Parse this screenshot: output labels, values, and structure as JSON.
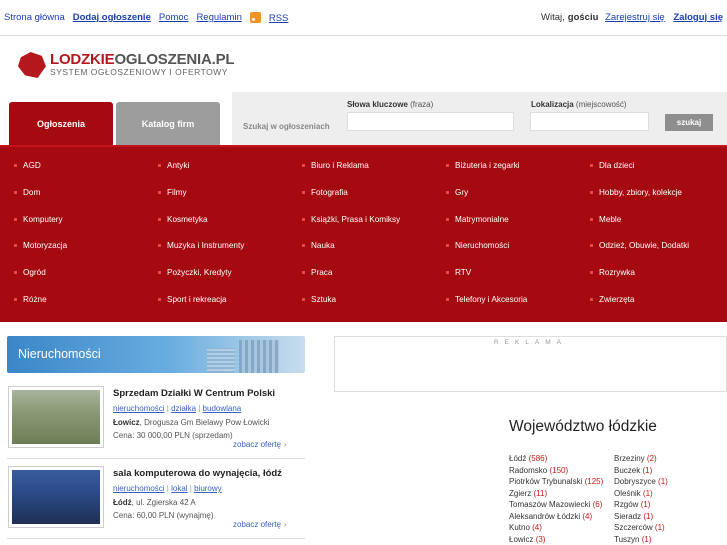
{
  "topbar": {
    "links": {
      "home": "Strona główna",
      "add": "Dodaj ogłoszenie",
      "help": "Pomoc",
      "terms": "Regulamin",
      "rss": "RSS"
    },
    "greeting_prefix": "Witaj,",
    "greeting_user": "gościu",
    "register": "Zarejestruj się",
    "login": "Zaloguj się"
  },
  "logo": {
    "title_red": "LODZKIE",
    "title_gray": "OGLOSZENIA.PL",
    "subtitle": "SYSTEM OGŁOSZENIOWY I OFERTOWY"
  },
  "tabs": {
    "ads": "Ogłoszenia",
    "catalog": "Katalog firm"
  },
  "search": {
    "label": "Szukaj w ogłoszeniach",
    "keywords_label": "Słowa kluczowe",
    "keywords_hint": "(fraza)",
    "location_label": "Lokalizacja",
    "location_hint": "(miejscowość)",
    "keywords_value": "",
    "location_value": "",
    "button": "szukaj"
  },
  "categories": [
    "AGD",
    "Antyki",
    "Biuro i Reklama",
    "Biżuteria i zegarki",
    "Dla dzieci",
    "Dom",
    "Filmy",
    "Fotografia",
    "Gry",
    "Hobby, zbiory, kolekcje",
    "Komputery",
    "Kosmetyka",
    "Książki, Prasa i Komiksy",
    "Matrymonialne",
    "Meble",
    "Motoryzacja",
    "Muzyka i Instrumenty",
    "Nauka",
    "Nieruchomości",
    "Odzież, Obuwie, Dodatki",
    "Ogród",
    "Pożyczki, Kredyty",
    "Praca",
    "RTV",
    "Rozrywka",
    "Różne",
    "Sport i rekreacja",
    "Sztuka",
    "Telefony i Akcesoria",
    "Zwierzęta"
  ],
  "section": {
    "title": "Nieruchomości"
  },
  "listings": [
    {
      "title": "Sprzedam Działki W Centrum Polski",
      "tags": [
        "nieruchomości",
        "działka",
        "budowlana"
      ],
      "city": "Łowicz",
      "address": ", Drogusza Gm Bielawy Pow Łowicki",
      "price": "Cena: 30 000,00 PLN (sprzedam)",
      "more": "zobacz ofertę"
    },
    {
      "title": "sala komputerowa do wynajęcia, łódź",
      "tags": [
        "nieruchomości",
        "lokal",
        "biurowy"
      ],
      "city": "Łódź",
      "address": ", ul. Zgierska 42 A",
      "price": "Cena: 60,00 PLN (wynajmę)",
      "more": "zobacz ofertę"
    }
  ],
  "ad": {
    "label": "REKLAMA"
  },
  "region": {
    "title": "Województwo łódzkie",
    "col1": [
      {
        "name": "Łódź",
        "count": "(586)"
      },
      {
        "name": "Radomsko",
        "count": "(150)"
      },
      {
        "name": "Piotrków Trybunalski",
        "count": "(125)"
      },
      {
        "name": "Zgierz",
        "count": "(11)"
      },
      {
        "name": "Tomaszów Mazowiecki",
        "count": "(6)"
      },
      {
        "name": "Aleksandrów Łódzki",
        "count": "(4)"
      },
      {
        "name": "Kutno",
        "count": "(4)"
      },
      {
        "name": "Łowicz",
        "count": "(3)"
      }
    ],
    "col2": [
      {
        "name": "Brzeziny",
        "count": "(2)"
      },
      {
        "name": "Buczek",
        "count": "(1)"
      },
      {
        "name": "Dobryszyce",
        "count": "(1)"
      },
      {
        "name": "Oleśnik",
        "count": "(1)"
      },
      {
        "name": "Rzgów",
        "count": "(1)"
      },
      {
        "name": "Sieradz",
        "count": "(1)"
      },
      {
        "name": "Szczerców",
        "count": "(1)"
      },
      {
        "name": "Tuszyn",
        "count": "(1)"
      }
    ]
  }
}
